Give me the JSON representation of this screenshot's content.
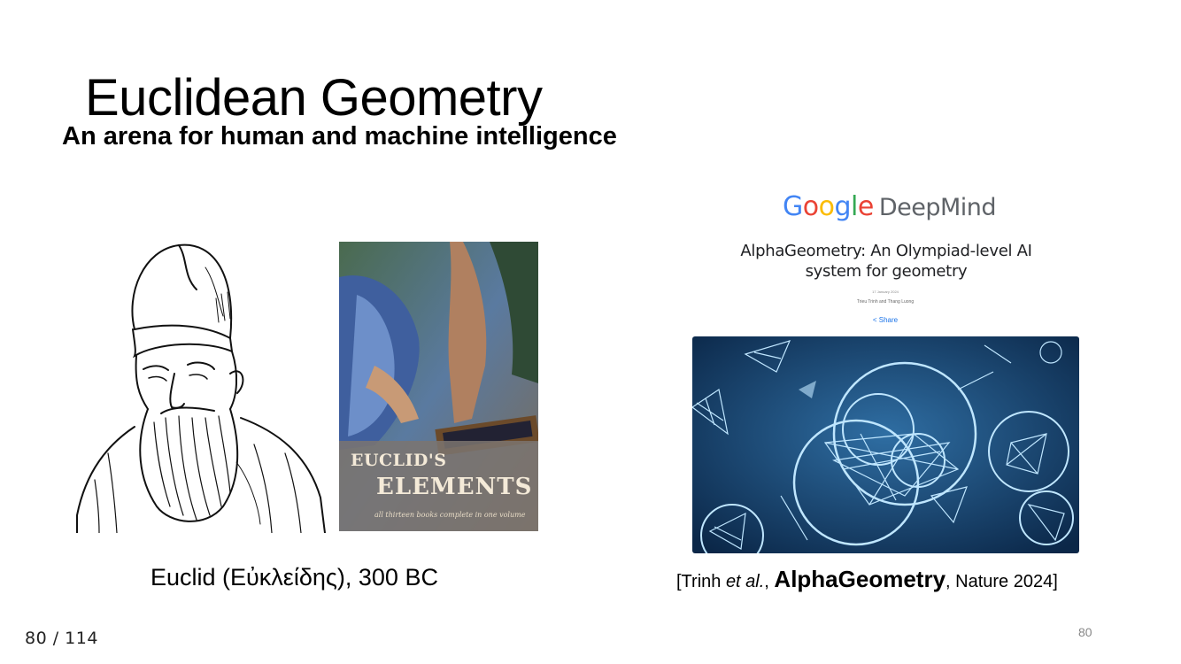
{
  "slide": {
    "title": "Euclidean Geometry",
    "subtitle": "An arena for human and machine intelligence",
    "slide_number": "80"
  },
  "left": {
    "book": {
      "title_line1": "EUCLID'S",
      "title_line2": "ELEMENTS",
      "tagline": "all thirteen books complete in one volume"
    },
    "caption": "Euclid (Εὐκλείδης), 300 BC"
  },
  "right": {
    "logo": {
      "google": [
        "G",
        "o",
        "o",
        "g",
        "l",
        "e"
      ],
      "deepmind": "DeepMind"
    },
    "blog_title": "AlphaGeometry: An Olympiad-level AI system for geometry",
    "blog_date": "17 January 2024",
    "blog_authors": "Trieu Trinh and Thang Luong",
    "blog_share": "< Share",
    "citation": {
      "open": "[Trinh ",
      "etal": "et al.",
      "sep": ", ",
      "name": "AlphaGeometry",
      "close": ", Nature 2024]"
    }
  },
  "viewer": {
    "page_counter": "80 / 114"
  },
  "colors": {
    "google_blue": "#4285F4",
    "google_red": "#EA4335",
    "google_yellow": "#FBBC05",
    "google_green": "#34A853",
    "hero_bg": "#123a63"
  }
}
